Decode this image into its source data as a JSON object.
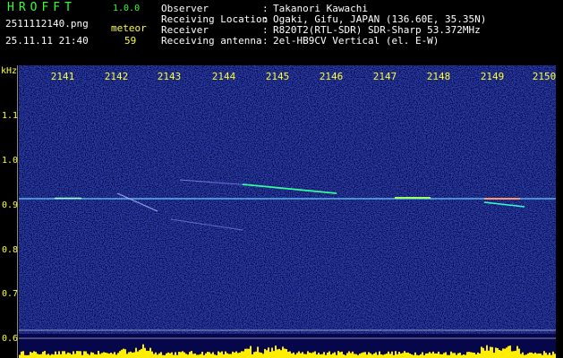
{
  "header": {
    "app_title": "HROFFT",
    "app_version": "1.0.0",
    "file_name": "2511112140.png",
    "date_time": "25.11.11 21:40",
    "mode_label": "meteor",
    "count_value": "59",
    "info": [
      {
        "label": "Observer",
        "value": "Takanori Kawachi"
      },
      {
        "label": "Receiving Location",
        "value": "Ogaki, Gifu, JAPAN (136.60E, 35.35N)"
      },
      {
        "label": "Receiver",
        "value": "R820T2(RTL-SDR) SDR-Sharp 53.372MHz"
      },
      {
        "label": "Receiving antenna",
        "value": "2el-HB9CV Vertical (el. E-W)"
      }
    ]
  },
  "axes": {
    "unit": "kHz",
    "x_ticks": [
      "2141",
      "2142",
      "2143",
      "2144",
      "2145",
      "2146",
      "2147",
      "2148",
      "2149",
      "2150"
    ],
    "y_ticks": [
      "1.1",
      "1.0",
      "0.9",
      "0.8",
      "0.7",
      "0.6"
    ]
  },
  "colors": {
    "background": "#06064a",
    "text_white": "#ffffff",
    "text_green": "#33ff33",
    "text_yellow": "#ffff33"
  }
}
